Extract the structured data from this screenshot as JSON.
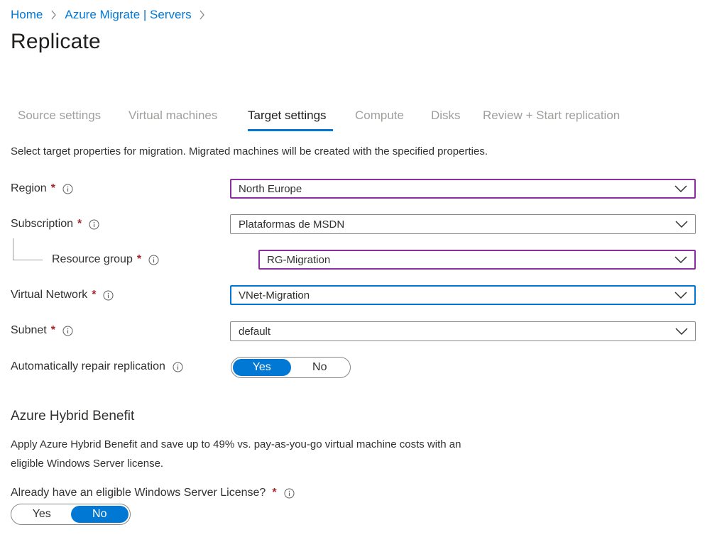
{
  "breadcrumb": {
    "items": [
      {
        "label": "Home"
      },
      {
        "label": "Azure Migrate | Servers"
      }
    ]
  },
  "page": {
    "title": "Replicate",
    "description": "Select target properties for migration. Migrated machines will be created with the specified properties."
  },
  "tabs": [
    {
      "label": "Source settings"
    },
    {
      "label": "Virtual machines"
    },
    {
      "label": "Target settings",
      "active": true
    },
    {
      "label": "Compute"
    },
    {
      "label": "Disks"
    },
    {
      "label": "Review + Start replication"
    }
  ],
  "form": {
    "region": {
      "label": "Region",
      "required": "*",
      "value": "North Europe"
    },
    "subscription": {
      "label": "Subscription",
      "required": "*",
      "value": "Plataformas de MSDN"
    },
    "resource_group": {
      "label": "Resource group",
      "required": "*",
      "value": "RG-Migration"
    },
    "virtual_network": {
      "label": "Virtual Network",
      "required": "*",
      "value": "VNet-Migration"
    },
    "subnet": {
      "label": "Subnet",
      "required": "*",
      "value": "default"
    },
    "auto_repair": {
      "label": "Automatically repair replication",
      "yes": "Yes",
      "no": "No",
      "selected": "Yes"
    }
  },
  "hybrid_benefit": {
    "title": "Azure Hybrid Benefit",
    "description": "Apply Azure Hybrid Benefit and save up to 49% vs. pay-as-you-go virtual machine costs with an eligible Windows Server license.",
    "license_question": {
      "label": "Already have an eligible Windows Server License?",
      "required": "*",
      "yes": "Yes",
      "no": "No",
      "selected": "No"
    }
  },
  "colors": {
    "accent": "#0078d4",
    "validation_border": "#8b2fa0",
    "required": "#a4262c"
  },
  "icons": {
    "breadcrumb_separator": "chevron-right-icon",
    "info": "info-icon",
    "dropdown": "chevron-down-icon"
  }
}
